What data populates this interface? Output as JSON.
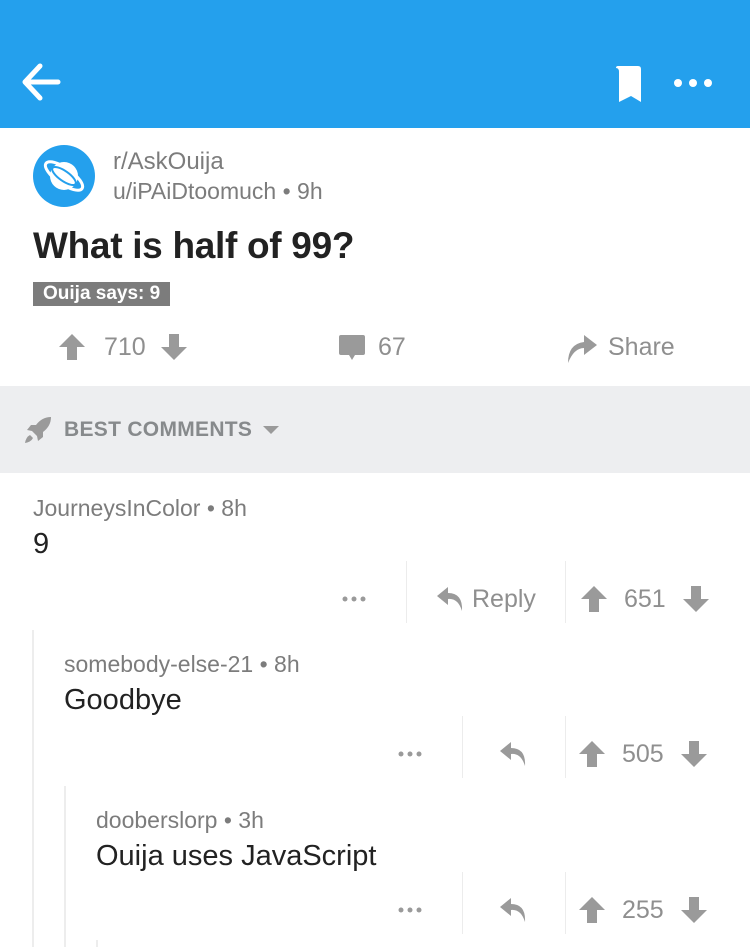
{
  "colors": {
    "brand_blue": "#24a0ed",
    "meta_gray": "#7c7c7c",
    "icon_gray": "#9a9a9a",
    "sort_bar_bg": "#edeef0"
  },
  "topbar": {
    "back_icon": "arrow-left-icon",
    "bookmark_icon": "bookmark-icon",
    "more_icon": "more-horizontal-icon"
  },
  "post": {
    "subreddit": "r/AskOuija",
    "author_line": "u/iPAiDtoomuch • 9h",
    "title": "What is half of 99?",
    "flair": "Ouija says: 9",
    "score": "710",
    "comment_count": "67",
    "share_label": "Share"
  },
  "sort": {
    "icon": "rocket-icon",
    "label": "BEST COMMENTS"
  },
  "comments": [
    {
      "meta": "JourneysInColor • 8h",
      "body": "9",
      "reply_label": "Reply",
      "score": "651"
    },
    {
      "meta": "somebody-else-21 • 8h",
      "body": "Goodbye",
      "score": "505"
    },
    {
      "meta": "dooberslorp • 3h",
      "body": "Ouija uses JavaScript",
      "score": "255"
    }
  ]
}
